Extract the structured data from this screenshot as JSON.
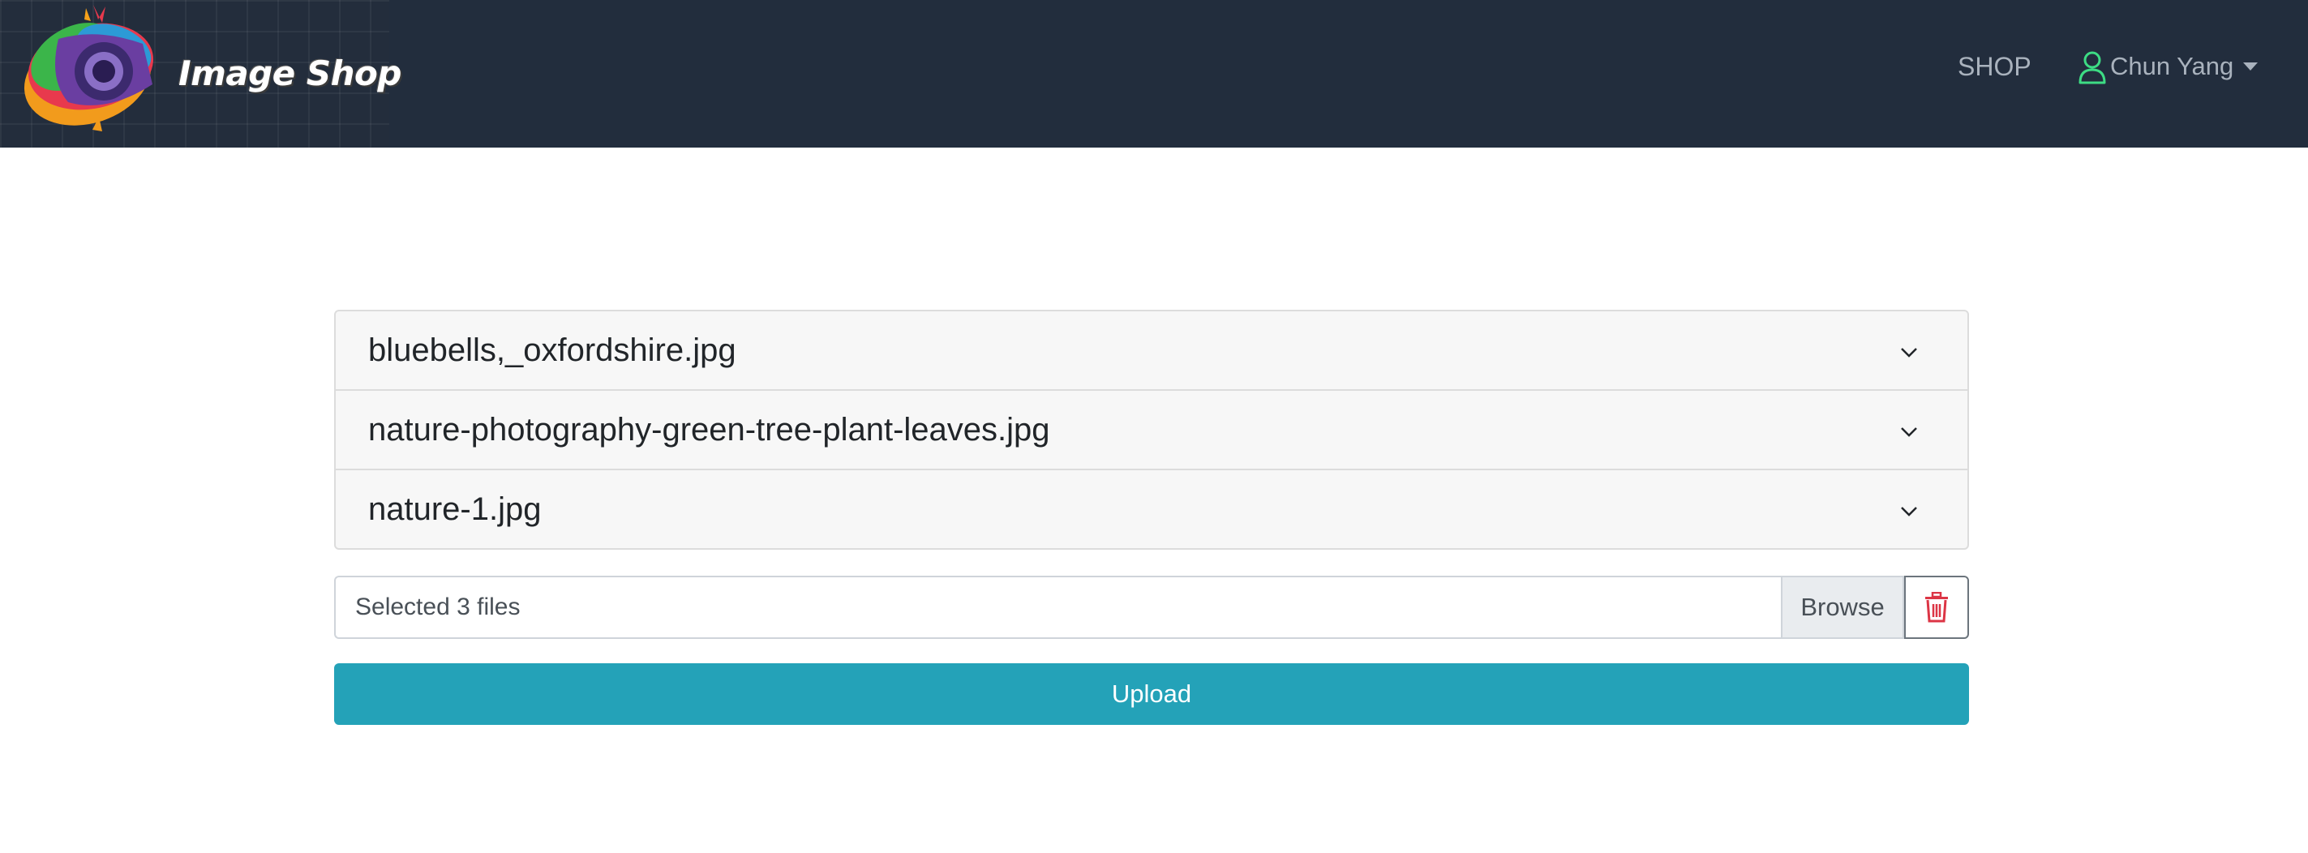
{
  "navbar": {
    "brand": "Image Shop",
    "logo_icon": "camera-logo-icon",
    "shop_link": "SHOP",
    "user_name": "Chun Yang",
    "user_icon": "person-outline-icon",
    "user_icon_color": "#3ddc84"
  },
  "files": {
    "items": [
      {
        "label": "bluebells,_oxfordshire.jpg"
      },
      {
        "label": "nature-photography-green-tree-plant-leaves.jpg"
      },
      {
        "label": "nature-1.jpg"
      }
    ],
    "chevron_icon": "chevron-down-icon"
  },
  "file_input": {
    "value": "Selected 3 files",
    "browse_label": "Browse",
    "delete_icon": "trash-icon",
    "delete_color": "#dc3545"
  },
  "upload": {
    "label": "Upload",
    "color": "#24a2b8"
  }
}
